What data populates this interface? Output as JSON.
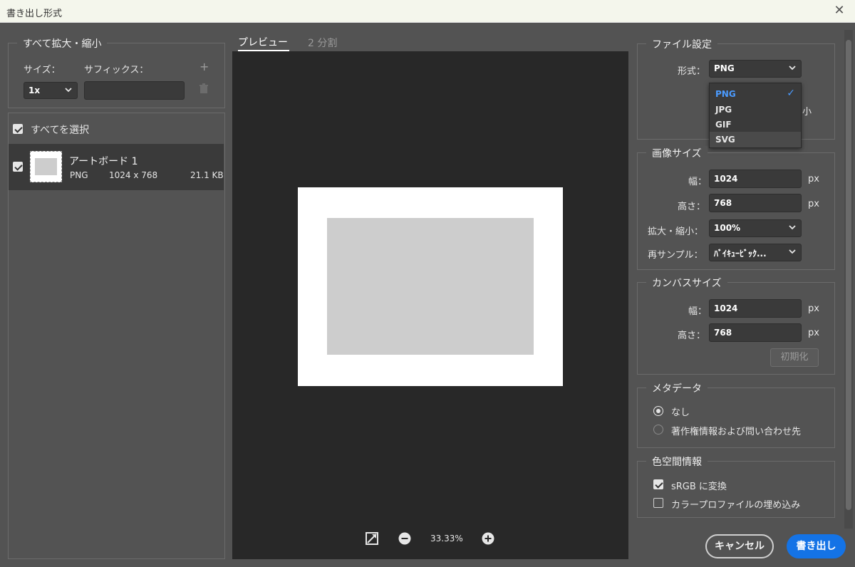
{
  "window": {
    "title": "書き出し形式",
    "close_glyph": "✕"
  },
  "scale_all": {
    "legend": "すべて拡大・縮小",
    "size_label": "サイズ：",
    "suffix_label": "サフィックス：",
    "size_value": "1x",
    "suffix_value": "",
    "add_glyph": "+",
    "trash_glyph": "🗑"
  },
  "asset_list": {
    "select_all_label": "すべてを選択",
    "items": [
      {
        "name": "アートボード 1",
        "format": "PNG",
        "dimensions": "1024 x 768",
        "size": "21.1 KB"
      }
    ]
  },
  "preview_tabs": {
    "preview": "プレビュー",
    "split": "2 分割"
  },
  "zoom": {
    "value": "33.33%"
  },
  "file_settings": {
    "legend": "ファイル設定",
    "format_label": "形式：",
    "format_value": "PNG",
    "partial_text": "小",
    "options": [
      "PNG",
      "JPG",
      "GIF",
      "SVG"
    ],
    "selected_option": "PNG",
    "check_glyph": "✓"
  },
  "image_size": {
    "legend": "画像サイズ",
    "width_label": "幅：",
    "width_value": "1024",
    "height_label": "高さ：",
    "height_value": "768",
    "unit": "px",
    "scale_label": "拡大・縮小：",
    "scale_value": "100%",
    "resample_label": "再サンプル：",
    "resample_value": "ﾊﾞｲｷｭｰﾋﾞｯｸ..."
  },
  "canvas_size": {
    "legend": "カンバスサイズ",
    "width_label": "幅：",
    "width_value": "1024",
    "height_label": "高さ：",
    "height_value": "768",
    "unit": "px",
    "reset_label": "初期化"
  },
  "metadata": {
    "legend": "メタデータ",
    "options": [
      "なし",
      "著作権情報および問い合わせ先"
    ],
    "selected": "なし"
  },
  "color_space": {
    "legend": "色空間情報",
    "srgb_label": "sRGB に変換",
    "srgb_checked": true,
    "embed_label": "カラープロファイルの埋め込み",
    "embed_checked": false
  },
  "actions": {
    "cancel": "キャンセル",
    "export": "書き出し"
  },
  "colors": {
    "accent": "#1473e6",
    "dropdown_selected": "#4b9bff"
  }
}
